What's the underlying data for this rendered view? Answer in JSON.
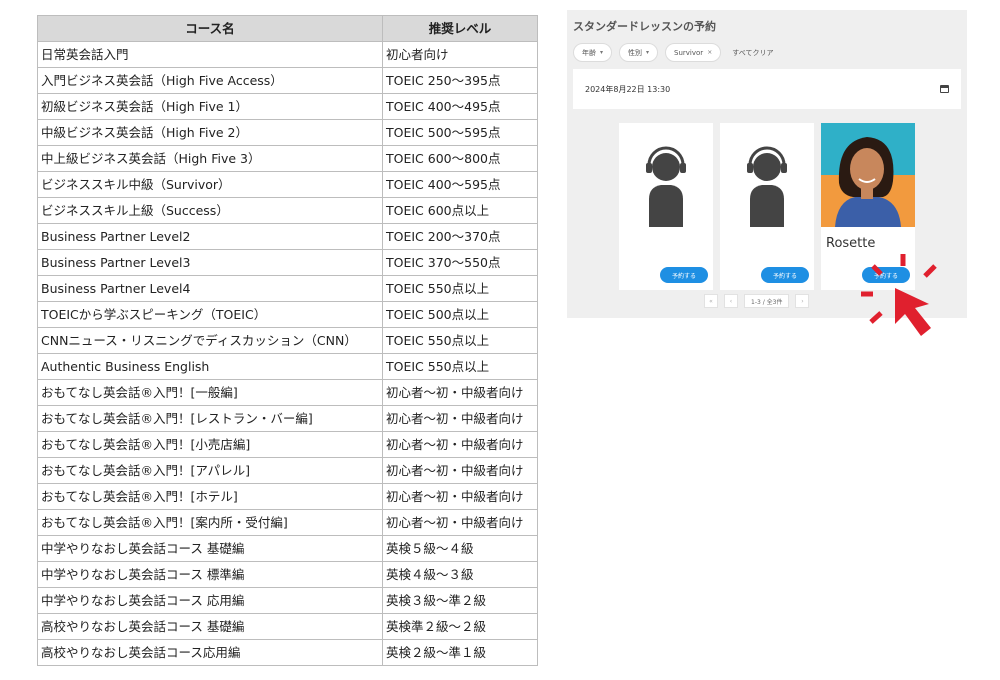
{
  "table": {
    "headers": [
      "コース名",
      "推奨レベル"
    ],
    "rows": [
      [
        "日常英会話入門",
        "初心者向け"
      ],
      [
        "入門ビジネス英会話（High Five Access）",
        "TOEIC 250～395点"
      ],
      [
        "初級ビジネス英会話（High Five 1）",
        "TOEIC 400～495点"
      ],
      [
        "中級ビジネス英会話（High Five 2）",
        "TOEIC 500～595点"
      ],
      [
        "中上級ビジネス英会話（High Five 3）",
        "TOEIC 600～800点"
      ],
      [
        "ビジネススキル中級（Survivor）",
        "TOEIC 400～595点"
      ],
      [
        "ビジネススキル上級（Success）",
        "TOEIC 600点以上"
      ],
      [
        "Business Partner Level2",
        "TOEIC 200～370点"
      ],
      [
        "Business Partner Level3",
        "TOEIC 370～550点"
      ],
      [
        "Business Partner Level4",
        "TOEIC 550点以上"
      ],
      [
        "TOEICから学ぶスピーキング（TOEIC）",
        "TOEIC 500点以上"
      ],
      [
        "CNNニュース・リスニングでディスカッション（CNN）",
        "TOEIC 550点以上"
      ],
      [
        "Authentic Business English",
        "TOEIC 550点以上"
      ],
      [
        "おもてなし英会話®入門！[一般編]",
        "初心者～初・中級者向け"
      ],
      [
        "おもてなし英会話®入門！[レストラン・バー編]",
        "初心者～初・中級者向け"
      ],
      [
        "おもてなし英会話®入門！[小売店編]",
        "初心者～初・中級者向け"
      ],
      [
        "おもてなし英会話®入門！[アパレル]",
        "初心者～初・中級者向け"
      ],
      [
        "おもてなし英会話®入門！[ホテル]",
        "初心者～初・中級者向け"
      ],
      [
        "おもてなし英会話®入門！[案内所・受付編]",
        "初心者～初・中級者向け"
      ],
      [
        "中学やりなおし英会話コース 基礎編",
        "英検５級～４級"
      ],
      [
        "中学やりなおし英会話コース 標準編",
        "英検４級～３級"
      ],
      [
        "中学やりなおし英会話コース 応用編",
        "英検３級～準２級"
      ],
      [
        "高校やりなおし英会話コース 基礎編",
        "英検準２級～２級"
      ],
      [
        "高校やりなおし英会話コース応用編",
        "英検２級～準１級"
      ]
    ]
  },
  "booking": {
    "title": "スタンダードレッスンの予約",
    "filters": [
      {
        "label": "年齢",
        "caret": "▾"
      },
      {
        "label": "性別",
        "caret": "▾"
      },
      {
        "label": "Survivor",
        "caret": "×"
      }
    ],
    "clear_all": "すべてクリア",
    "datetime": "2024年8月22日 13:30",
    "cards": [
      {
        "name": "",
        "button": "予約する",
        "avatar": "placeholder"
      },
      {
        "name": "",
        "button": "予約する",
        "avatar": "placeholder"
      },
      {
        "name": "Rosette",
        "button": "予約する",
        "avatar": "photo"
      }
    ],
    "pager": {
      "first": "«",
      "prev": "‹",
      "info": "1-3 / 全3件",
      "next": "›"
    }
  },
  "colors": {
    "accent": "#1e8fe3",
    "highlight": "#e0202e"
  }
}
